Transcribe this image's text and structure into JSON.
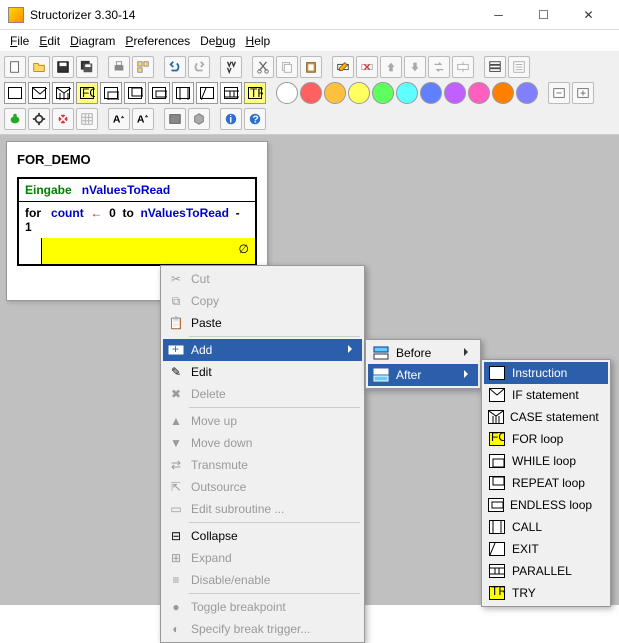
{
  "window": {
    "title": "Structorizer 3.30-14"
  },
  "menubar": {
    "file": "File",
    "edit": "Edit",
    "diagram": "Diagram",
    "preferences": "Preferences",
    "debug": "Debug",
    "help": "Help"
  },
  "colors": [
    "#ffffff",
    "#ff3030",
    "#ffc000",
    "#ffff40",
    "#40ff40",
    "#40ffff",
    "#4080ff",
    "#c040ff",
    "#ff40c0",
    "#ff8000",
    "#8080ff"
  ],
  "diagram": {
    "title": "FOR_DEMO",
    "input_kw": "Eingabe",
    "input_var": "nValuesToRead",
    "for_kw": "for",
    "for_var": "count",
    "for_arrow": "←",
    "for_from": "0",
    "for_to_kw": "to",
    "for_to_var": "nValuesToRead",
    "for_minus": "- 1"
  },
  "context_main": {
    "cut": "Cut",
    "copy": "Copy",
    "paste": "Paste",
    "add": "Add",
    "edit": "Edit",
    "delete": "Delete",
    "moveup": "Move up",
    "movedown": "Move down",
    "transmute": "Transmute",
    "outsource": "Outsource",
    "editsub": "Edit subroutine ...",
    "collapse": "Collapse",
    "expand": "Expand",
    "disable": "Disable/enable",
    "togglebp": "Toggle breakpoint",
    "specifybp": "Specify break trigger..."
  },
  "context_add": {
    "before": "Before",
    "after": "After"
  },
  "context_elems": {
    "instruction": "Instruction",
    "if": "IF statement",
    "case": "CASE statement",
    "for": "FOR loop",
    "while": "WHILE loop",
    "repeat": "REPEAT loop",
    "endless": "ENDLESS loop",
    "call": "CALL",
    "exit": "EXIT",
    "parallel": "PARALLEL",
    "try": "TRY"
  }
}
